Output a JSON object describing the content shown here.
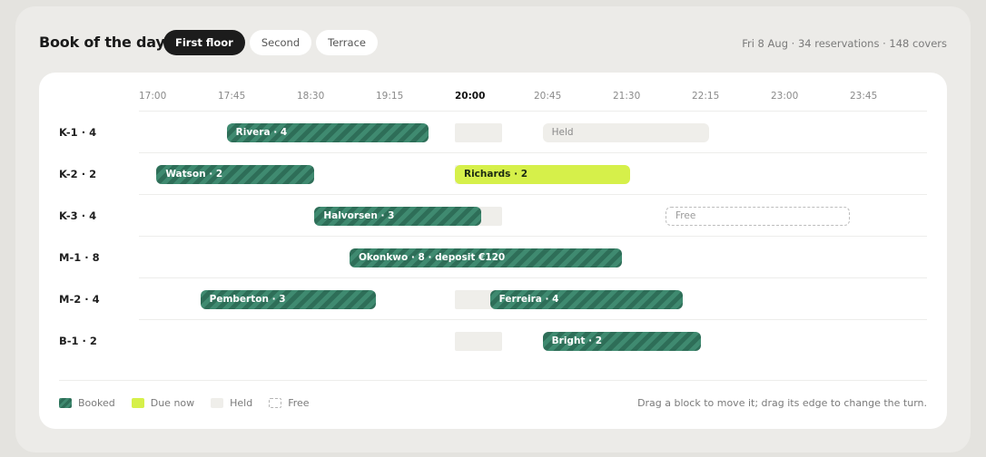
{
  "header": {
    "title": "Book of the day",
    "tabs": [
      {
        "label": "First floor",
        "active": true
      },
      {
        "label": "Second",
        "active": false
      },
      {
        "label": "Terrace",
        "active": false
      }
    ],
    "summary": "Fri 8 Aug · 34 reservations · 148 covers"
  },
  "timeline": {
    "ticks": [
      "17:00",
      "17:45",
      "18:30",
      "19:15",
      "20:00",
      "20:45",
      "21:30",
      "22:15",
      "23:00",
      "23:45"
    ],
    "current_tick": "20:00",
    "start": "17:00",
    "end": "00:20"
  },
  "tables": [
    {
      "label": "K-1 · 4",
      "blocks": [
        {
          "kind": "booked",
          "label": "Rivera · 4",
          "start": "17:50",
          "end": "19:45"
        },
        {
          "kind": "held",
          "label": "Held",
          "start": "20:50",
          "end": "22:25"
        }
      ]
    },
    {
      "label": "K-2 · 2",
      "blocks": [
        {
          "kind": "booked",
          "label": "Watson · 2",
          "start": "17:10",
          "end": "18:40"
        },
        {
          "kind": "due",
          "label": "Richards · 2",
          "start": "20:00",
          "end": "21:40"
        }
      ]
    },
    {
      "label": "K-3 · 4",
      "blocks": [
        {
          "kind": "booked",
          "label": "Halvorsen · 3",
          "start": "18:40",
          "end": "20:15"
        },
        {
          "kind": "free",
          "label": "Free",
          "start": "22:00",
          "end": "23:45"
        }
      ]
    },
    {
      "label": "M-1 · 8",
      "blocks": [
        {
          "kind": "booked",
          "label": "Okonkwo · 8 · deposit €120",
          "start": "19:00",
          "end": "21:35"
        }
      ]
    },
    {
      "label": "M-2 · 4",
      "blocks": [
        {
          "kind": "booked",
          "label": "Pemberton · 3",
          "start": "17:35",
          "end": "19:15"
        },
        {
          "kind": "booked",
          "label": "Ferreira · 4",
          "start": "20:20",
          "end": "22:10"
        }
      ]
    },
    {
      "label": "B-1 · 2",
      "blocks": [
        {
          "kind": "booked",
          "label": "Bright · 2",
          "start": "20:50",
          "end": "22:20"
        }
      ]
    }
  ],
  "legend": [
    {
      "kind": "booked",
      "label": "Booked"
    },
    {
      "kind": "due",
      "label": "Due now"
    },
    {
      "kind": "held",
      "label": "Held"
    },
    {
      "kind": "free",
      "label": "Free"
    }
  ],
  "hint": "Drag a block to move it; drag its edge to change the turn.",
  "colors": {
    "booked": "#2e6e58",
    "due": "#d6f04a",
    "held": "#efeeea",
    "active_tab": "#1c1c1c"
  }
}
